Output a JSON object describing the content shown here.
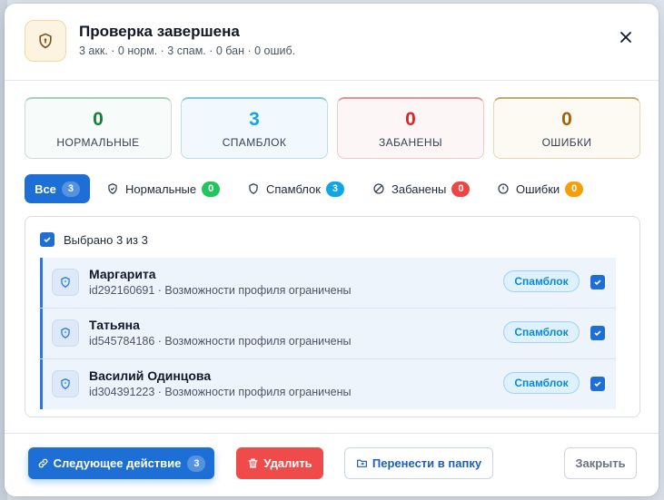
{
  "header": {
    "title": "Проверка завершена",
    "subtitle": "3 акк. · 0 норм. · 3 спам. · 0 бан · 0 ошиб."
  },
  "stats": [
    {
      "value": "0",
      "label": "НОРМАЛЬНЫЕ"
    },
    {
      "value": "3",
      "label": "СПАМБЛОК"
    },
    {
      "value": "0",
      "label": "ЗАБАНЕНЫ"
    },
    {
      "value": "0",
      "label": "ОШИБКИ"
    }
  ],
  "tabs": [
    {
      "label": "Все",
      "count": "3",
      "active": true
    },
    {
      "label": "Нормальные",
      "count": "0",
      "badge_color": "#22c55e"
    },
    {
      "label": "Спамблок",
      "count": "3",
      "badge_color": "#0ea5e9"
    },
    {
      "label": "Забанены",
      "count": "0",
      "badge_color": "#ef4444"
    },
    {
      "label": "Ошибки",
      "count": "0",
      "badge_color": "#f59e0b"
    }
  ],
  "list": {
    "select_all_label": "Выбрано 3 из 3",
    "rows": [
      {
        "name": "Маргарита",
        "detail": "id292160691 · Возможности профиля ограничены",
        "status": "Спамблок",
        "checked": true
      },
      {
        "name": "Татьяна",
        "detail": "id545784186 · Возможности профиля ограничены",
        "status": "Спамблок",
        "checked": true
      },
      {
        "name": "Василий Одинцова",
        "detail": "id304391223 · Возможности профиля ограничены",
        "status": "Спамблок",
        "checked": true
      }
    ]
  },
  "footer": {
    "next_label": "Следующее действие",
    "next_count": "3",
    "delete_label": "Удалить",
    "move_label": "Перенести в папку",
    "close_label": "Закрыть"
  },
  "colors": {
    "accent": "#1d6fd6",
    "danger": "#ef4b4b",
    "spam": "#0ea5e9",
    "normal": "#15803d",
    "banned": "#dc2626",
    "errors": "#a16207"
  }
}
